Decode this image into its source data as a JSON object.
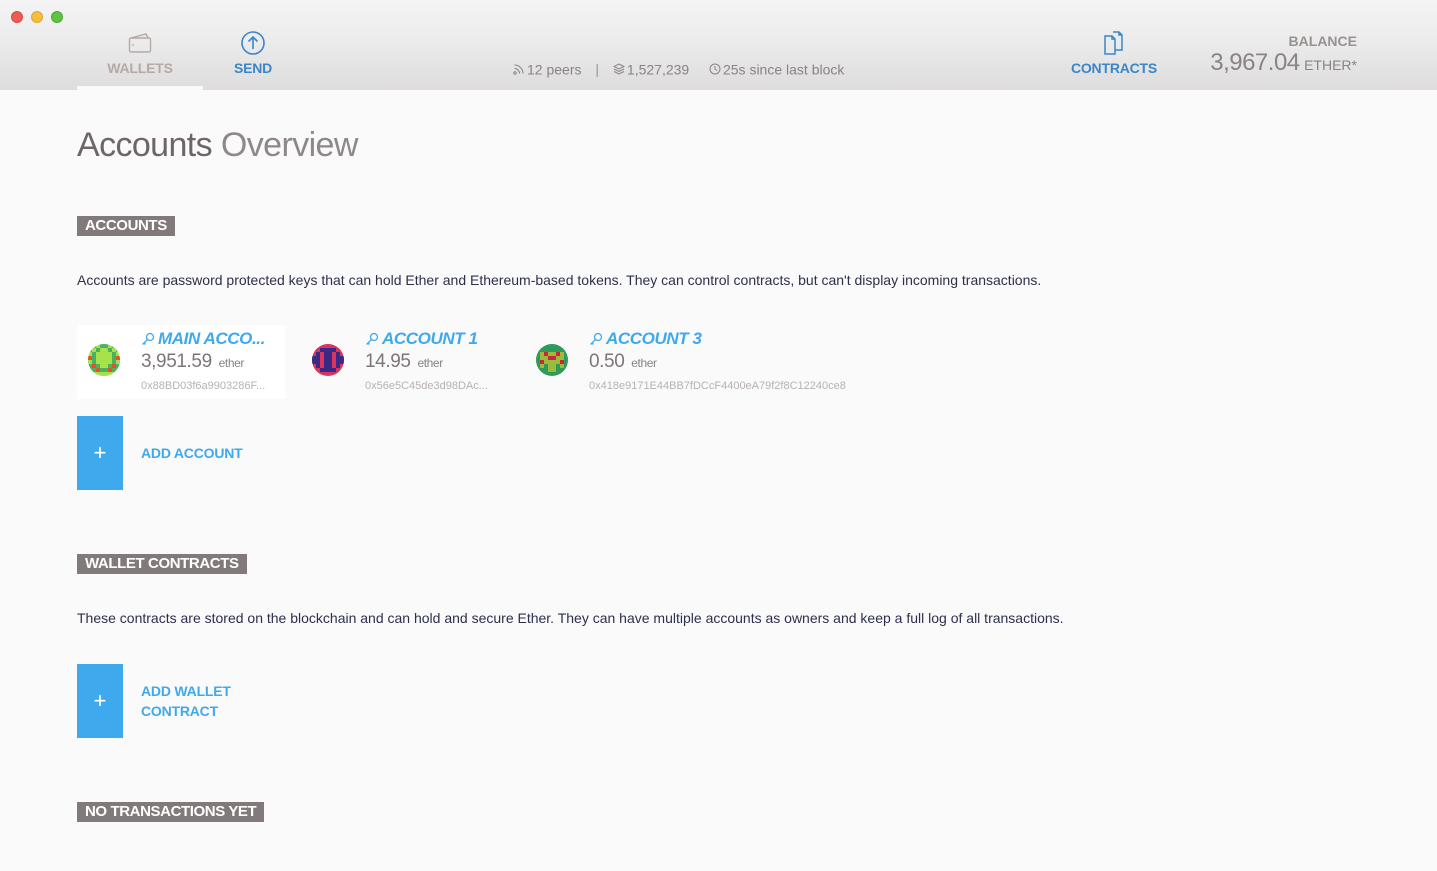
{
  "window": {
    "traffic_lights": [
      "close",
      "minimize",
      "maximize"
    ]
  },
  "nav": {
    "wallets": {
      "label": "WALLETS",
      "icon": "wallet-icon",
      "active": true
    },
    "send": {
      "label": "SEND",
      "icon": "arrow-up-circle-icon"
    },
    "contracts": {
      "label": "CONTRACTS",
      "icon": "documents-icon"
    }
  },
  "status": {
    "peers": "12 peers",
    "separator": "|",
    "block_number": "1,527,239",
    "since_last_block": "25s since last block"
  },
  "balance": {
    "label": "BALANCE",
    "value": "3,967.04",
    "unit": "ETHER*"
  },
  "page": {
    "title_bold": "Accounts",
    "title_thin": "Overview"
  },
  "accounts_section": {
    "tag": "ACCOUNTS",
    "description": "Accounts are password protected keys that can hold Ether and Ethereum-based tokens. They can control contracts, but can't display incoming transactions.",
    "accounts": [
      {
        "name": "MAIN ACCO...",
        "amount": "3,951.59",
        "unit": "ether",
        "address": "0x88BD03f6a9903286F...",
        "selected": true
      },
      {
        "name": "ACCOUNT 1",
        "amount": "14.95",
        "unit": "ether",
        "address": "0x56e5C45de3d98DAc...",
        "selected": false
      },
      {
        "name": "ACCOUNT 3",
        "amount": "0.50",
        "unit": "ether",
        "address": "0x418e9171E44BB7fDCcF4400eA79f2f8C12240ce8",
        "selected": false
      }
    ],
    "add_button": {
      "icon": "+",
      "label": "ADD ACCOUNT"
    }
  },
  "wallet_contracts_section": {
    "tag": "WALLET CONTRACTS",
    "description": "These contracts are stored on the blockchain and can hold and secure Ether. They can have multiple accounts as owners and keep a full log of all transactions.",
    "add_button": {
      "icon": "+",
      "label_line1": "ADD WALLET",
      "label_line2": "CONTRACT"
    }
  },
  "transactions_section": {
    "tag": "NO TRANSACTIONS YET"
  },
  "colors": {
    "accent_blue": "#3ea9ed",
    "nav_blue": "#3a86c8",
    "tag_gray": "#827a7a",
    "background": "#fafafa"
  }
}
